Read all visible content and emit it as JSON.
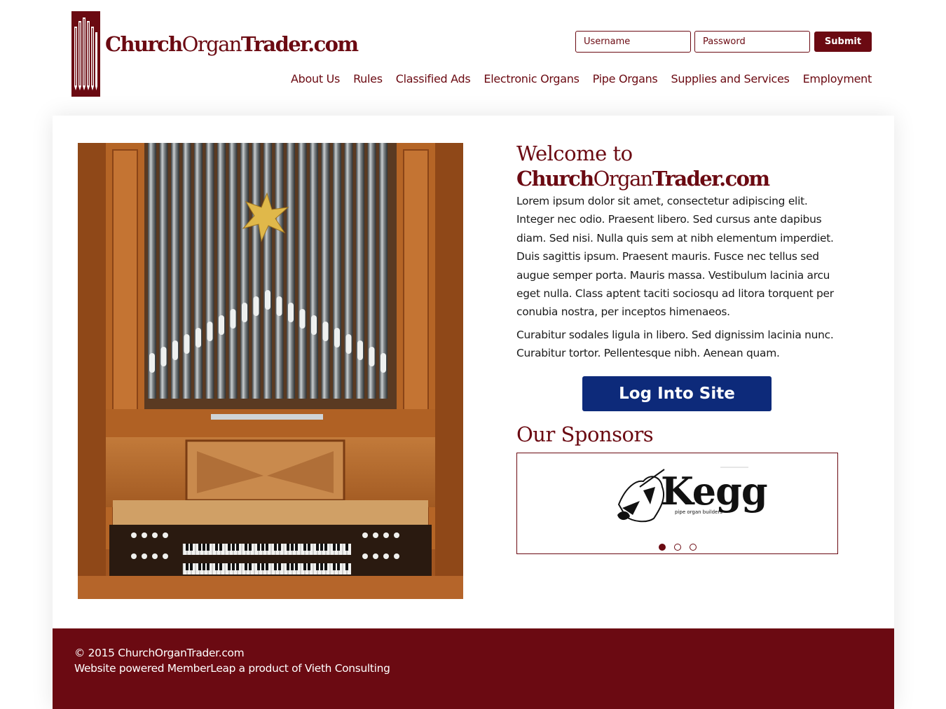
{
  "brand": {
    "name_part1": "Church",
    "name_part2": "Organ",
    "name_part3": "Trader.com",
    "color": "#6b0a12"
  },
  "login": {
    "username_placeholder": "Username",
    "password_placeholder": "Password",
    "submit_label": "Submit"
  },
  "nav": {
    "items": [
      {
        "label": "About Us"
      },
      {
        "label": "Rules"
      },
      {
        "label": "Classified Ads"
      },
      {
        "label": "Electronic Organs"
      },
      {
        "label": "Pipe Organs"
      },
      {
        "label": "Supplies and Services"
      },
      {
        "label": "Employment"
      }
    ]
  },
  "main": {
    "welcome_prefix": "Welcome to",
    "welcome_brand_1": "Church",
    "welcome_brand_2": "Organ",
    "welcome_brand_3": "Trader.com",
    "paragraph_1": "Lorem ipsum dolor sit amet, consectetur adipiscing elit. Integer nec odio. Praesent libero. Sed cursus ante dapibus diam. Sed nisi. Nulla quis sem at nibh elementum imperdiet. Duis sagittis ipsum. Praesent mauris. Fusce nec tellus sed augue semper porta. Mauris massa. Vestibulum lacinia arcu eget nulla. Class aptent taciti sociosqu ad litora torquent per conubia nostra, per inceptos himenaeos.",
    "paragraph_2": "Curabitur sodales ligula in libero. Sed dignissim lacinia nunc. Curabitur tortor. Pellentesque nibh. Aenean quam.",
    "login_button": "Log Into Site",
    "login_button_color": "#0d2a7a",
    "sponsors_heading": "Our Sponsors",
    "sponsor": {
      "name": "Kegg",
      "tagline": "pipe organ builders"
    },
    "carousel_dots": 3,
    "carousel_active": 1
  },
  "footer": {
    "copyright": "© 2015 ChurchOrganTrader.com",
    "powered_by": "Website powered MemberLeap a product of Vieth Consulting"
  }
}
